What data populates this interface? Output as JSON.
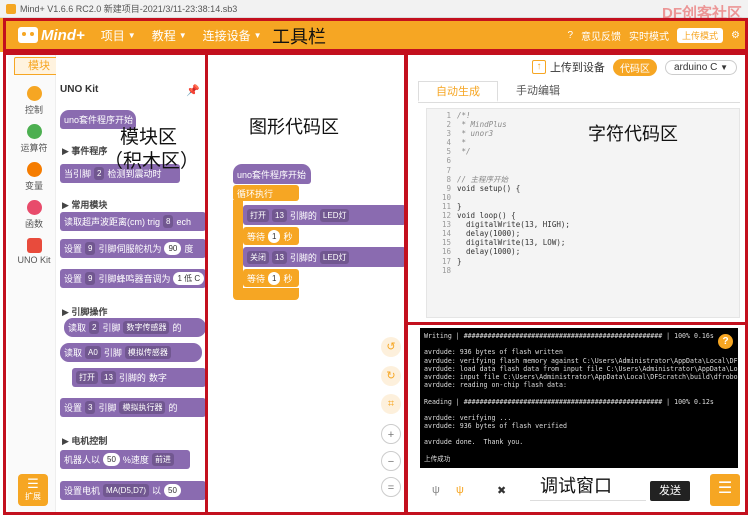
{
  "titlebar": {
    "text": "Mind+ V1.6.6 RC2.0   新建项目-2021/3/11-23:38:14.sb3"
  },
  "watermark": "DF创客社区",
  "toolbar": {
    "brand": "Mind+",
    "menus": [
      "项目",
      "教程",
      "连接设备"
    ],
    "right": {
      "feedback": "意见反馈",
      "realtime": "实时模式",
      "upload_mode": "上传模式"
    }
  },
  "annotations": {
    "toolbar": "工具栏",
    "block_area_1": "模块区",
    "block_area_2": "（积木区）",
    "graphic_code": "图形代码区",
    "char_code": "字符代码区",
    "debug": "调试窗口"
  },
  "categories": {
    "tab": "模块",
    "items": [
      {
        "label": "控制",
        "color": "#f6a623"
      },
      {
        "label": "运算符",
        "color": "#4caf50"
      },
      {
        "label": "变量",
        "color": "#f57c00"
      },
      {
        "label": "函数",
        "color": "#e84b6b"
      },
      {
        "label": "UNO Kit",
        "color": "#e84b3c"
      }
    ],
    "expand": "扩展"
  },
  "palette": {
    "title": "UNO Kit",
    "program_start": "uno套件程序开始",
    "sections": [
      "事件程序",
      "常用模块",
      "引脚操作",
      "电机控制"
    ],
    "blocks": {
      "b1": [
        "当引脚",
        "2",
        "检测到震动时"
      ],
      "b2": [
        "读取超声波距离(cm) trig",
        "8",
        "ech"
      ],
      "b3": [
        "设置",
        "9",
        "引脚伺服舵机为",
        "90",
        "度"
      ],
      "b4": [
        "设置",
        "9",
        "引脚蜂鸣器音调为",
        "1 低 C"
      ],
      "b5": [
        "读取",
        "2",
        "引脚",
        "数字传感器",
        "的"
      ],
      "b6": [
        "读取",
        "A0",
        "引脚",
        "模拟传感器"
      ],
      "b7": [
        "打开",
        "13",
        "引脚的",
        "数字"
      ],
      "b8": [
        "设置",
        "3",
        "引脚",
        "模拟执行器",
        "的"
      ],
      "b9": [
        "机器人以",
        "50",
        "%速度",
        "前进"
      ],
      "b10": [
        "设置电机",
        "MA(D5,D7)",
        "以",
        "50"
      ]
    }
  },
  "workspace": {
    "start": "uno套件程序开始",
    "loop": "循环执行",
    "row1": [
      "打开",
      "13",
      "引脚的",
      "LED灯"
    ],
    "wait1": [
      "等待",
      "1",
      "秒"
    ],
    "row2": [
      "关闭",
      "13",
      "引脚的",
      "LED灯"
    ],
    "wait2": [
      "等待",
      "1",
      "秒"
    ]
  },
  "code_panel": {
    "upload": "上传到设备",
    "toggle": "代码区",
    "board": "arduino C",
    "tabs": [
      "自动生成",
      "手动编辑"
    ],
    "line_numbers": [
      "1",
      "2",
      "3",
      "4",
      "5",
      "6",
      "7",
      "8",
      "9",
      "10",
      "11",
      "12",
      "13",
      "14",
      "15",
      "16",
      "17",
      "18"
    ],
    "lines": [
      "/*!",
      " * MindPlus",
      " * unor3",
      " *",
      " */",
      "",
      "",
      "// 主程序开始",
      "void setup() {",
      "",
      "}",
      "void loop() {",
      "  digitalWrite(13, HIGH);",
      "  delay(1000);",
      "  digitalWrite(13, LOW);",
      "  delay(1000);",
      "}",
      ""
    ]
  },
  "console": {
    "lines": [
      "Writing | ################################################## | 100% 0.16s",
      "",
      "avrdude: 936 bytes of flash written",
      "avrdude: verifying flash memory against C:\\Users\\Administrator\\AppData\\Local\\DF",
      "avrdude: load data flash data from input file C:\\Users\\Administrator\\AppData\\Loca",
      "avrdude: input file C:\\Users\\Administrator\\AppData\\Local\\DFScratch\\build\\dfrobot",
      "avrdude: reading on-chip flash data:",
      "",
      "Reading | ################################################## | 100% 0.12s",
      "",
      "avrdude: verifying ...",
      "avrdude: 936 bytes of flash verified",
      "",
      "avrdude done.  Thank you.",
      "",
      "上传成功"
    ],
    "send": "发送"
  }
}
